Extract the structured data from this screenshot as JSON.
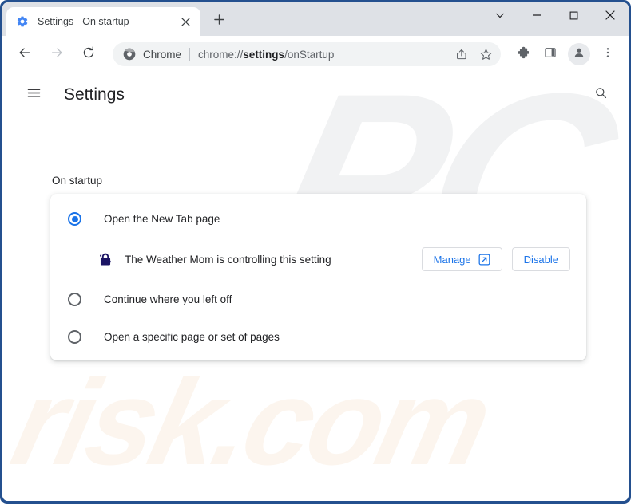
{
  "window": {
    "controls": [
      {
        "name": "tab-search-chevron",
        "icon": "chevron-down-icon"
      },
      {
        "name": "minimize",
        "icon": "minimize-icon"
      },
      {
        "name": "maximize",
        "icon": "maximize-icon"
      },
      {
        "name": "close",
        "icon": "close-icon"
      }
    ]
  },
  "tab": {
    "title": "Settings - On startup",
    "favicon": "gear-icon",
    "close_icon": "close-icon",
    "new_tab_icon": "plus-icon"
  },
  "toolbar": {
    "back_icon": "arrow-left-icon",
    "forward_icon": "arrow-right-icon",
    "reload_icon": "reload-icon",
    "omnibox": {
      "brand_icon": "chrome-logo-icon",
      "brand_label": "Chrome",
      "url_prefix": "chrome://",
      "url_bold": "settings",
      "url_suffix": "/onStartup",
      "share_icon": "share-icon",
      "bookmark_icon": "star-icon"
    },
    "extensions_icon": "puzzle-piece-icon",
    "side_panel_icon": "side-panel-icon",
    "avatar_icon": "profile-avatar-icon",
    "menu_icon": "three-dot-menu-icon"
  },
  "settings_page": {
    "menu_icon": "hamburger-menu-icon",
    "title": "Settings",
    "search_icon": "search-icon",
    "section_label": "On startup",
    "options": [
      {
        "label": "Open the New Tab page",
        "selected": true
      },
      {
        "label": "Continue where you left off",
        "selected": false
      },
      {
        "label": "Open a specific page or set of pages",
        "selected": false
      }
    ],
    "extension_notice": {
      "icon": "extension-lock-icon",
      "text": "The Weather Mom is controlling this setting",
      "manage_label": "Manage",
      "manage_icon": "external-link-icon",
      "disable_label": "Disable"
    }
  },
  "watermarks": {
    "top": "PC",
    "bottom": "risk.com"
  },
  "colors": {
    "accent_blue": "#1a73e8",
    "window_frame": "#24508f",
    "tab_strip": "#dee1e6",
    "omnibox_bg": "#f1f3f4",
    "text_primary": "#202124",
    "text_secondary": "#5f6368",
    "extension_icon": "#1b1464"
  }
}
